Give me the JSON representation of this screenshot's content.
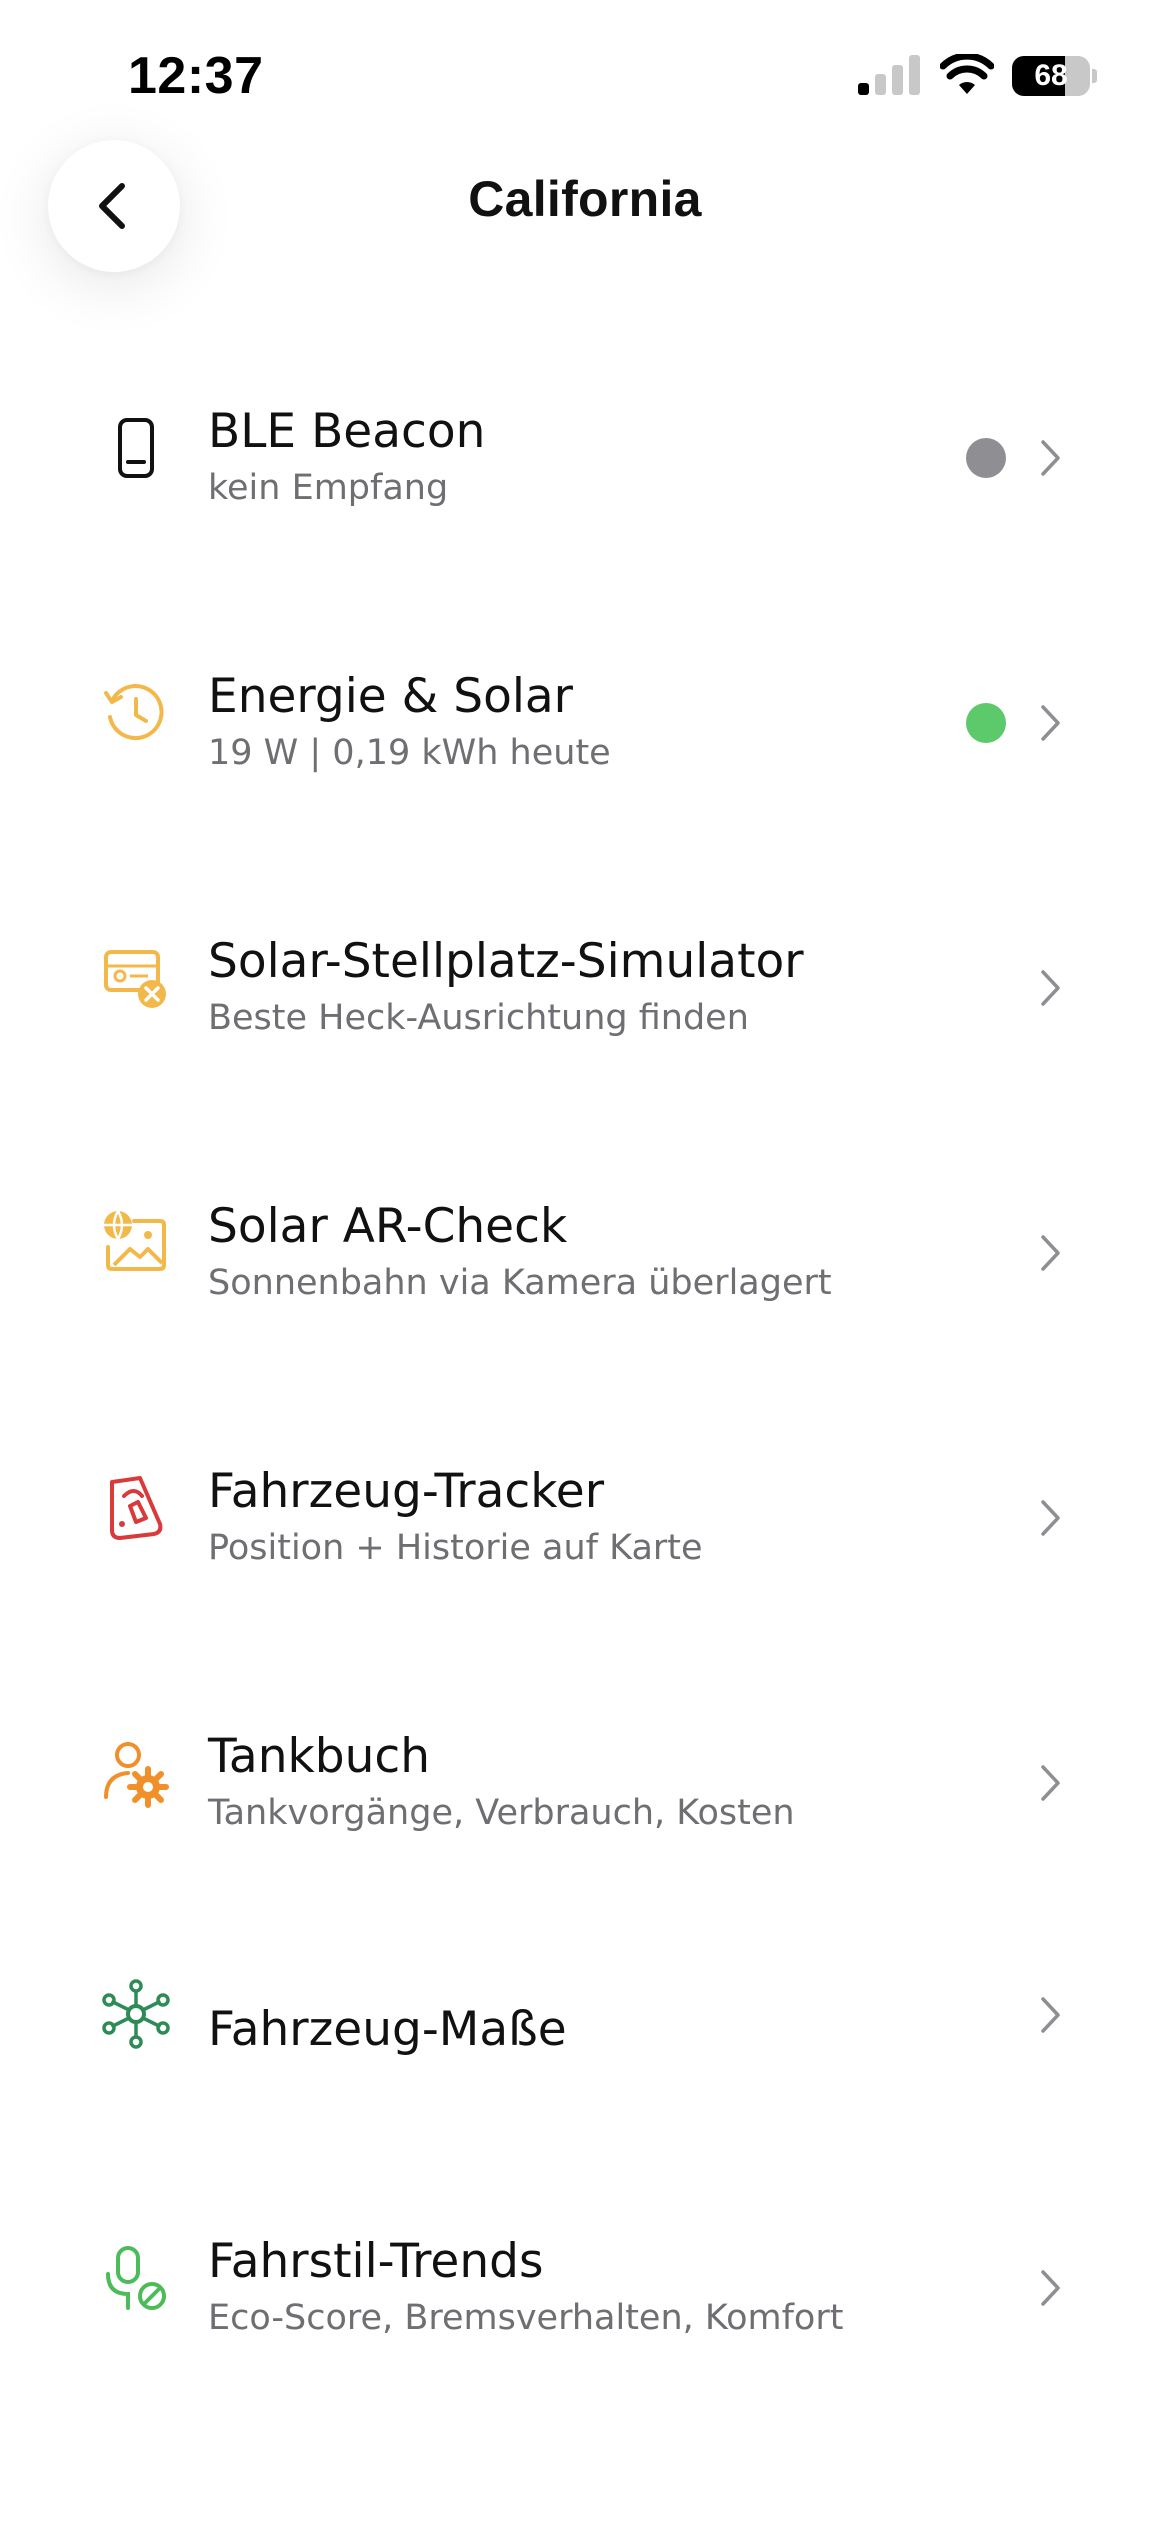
{
  "status_bar": {
    "time": "12:37",
    "battery_text": "68",
    "battery_level": 0.68,
    "signal_icon": "cellular-signal-icon",
    "wifi_icon": "wifi-icon"
  },
  "header": {
    "title": "California",
    "back_icon": "chevron-left-icon"
  },
  "colors": {
    "dot_gray": "#8e8e93",
    "dot_green": "#5cc96a",
    "icon_yellow": "#f2b94a",
    "icon_red": "#d93a3a",
    "icon_orange": "#f0902a",
    "icon_green_dark": "#2e8b57",
    "icon_green_light": "#4cbc5a",
    "chevron": "#8e8e93"
  },
  "items": [
    {
      "title": "BLE Beacon",
      "subtitle": "kein Empfang",
      "icon": "phone-icon",
      "status": "gray"
    },
    {
      "title": "Energie & Solar",
      "subtitle": "19 W | 0,19 kWh heute",
      "icon": "history-clock-icon",
      "status": "green"
    },
    {
      "title": "Solar-Stellplatz-Simulator",
      "subtitle": "Beste Heck-Ausrichtung finden",
      "icon": "solar-panel-icon"
    },
    {
      "title": "Solar AR-Check",
      "subtitle": "Sonnenbahn via Kamera überlagert",
      "icon": "globe-image-icon"
    },
    {
      "title": "Fahrzeug-Tracker",
      "subtitle": "Position + Historie auf Karte",
      "icon": "tracker-device-icon"
    },
    {
      "title": "Tankbuch",
      "subtitle": "Tankvorgänge, Verbrauch, Kosten",
      "icon": "person-gear-icon"
    },
    {
      "title": "Fahrzeug-Maße",
      "subtitle": "",
      "icon": "network-nodes-icon"
    },
    {
      "title": "Fahrstil-Trends",
      "subtitle": "Eco-Score, Bremsverhalten, Komfort",
      "icon": "microphone-off-icon"
    }
  ]
}
